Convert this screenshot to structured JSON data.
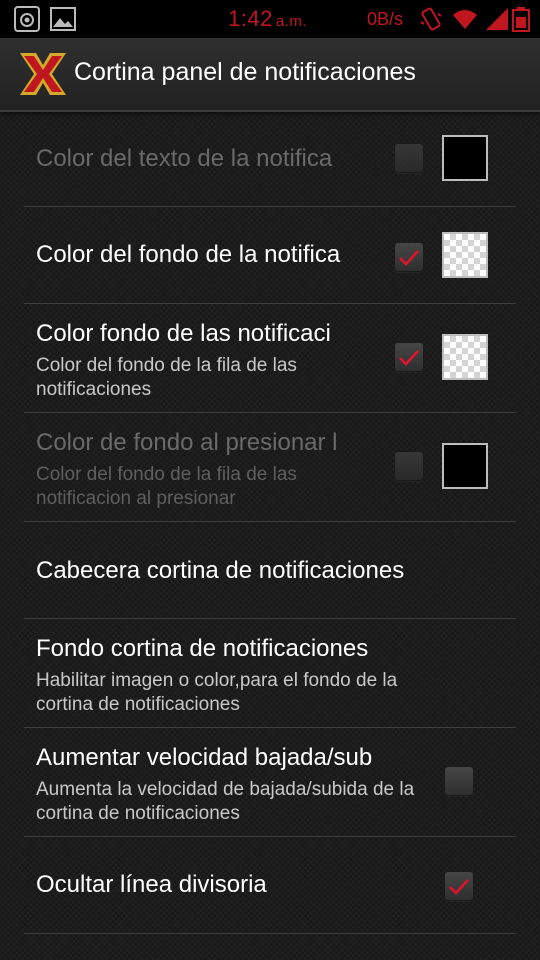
{
  "status_bar": {
    "time": "1:42",
    "ampm": "a.m.",
    "network_speed": "0B/s",
    "icons": [
      "screenshot-icon",
      "image-icon",
      "vibrate-icon",
      "wifi-icon",
      "signal-icon",
      "battery-icon"
    ]
  },
  "action_bar": {
    "title": "Cortina panel de notificaciones",
    "logo": "app-x-logo-icon"
  },
  "colors": {
    "accent": "#c0171f",
    "background": "#1c1c1c",
    "divider": "#3e3e3e"
  },
  "preferences": [
    {
      "title": "Color del texto de la notifica",
      "summary": "",
      "checked": false,
      "enabled": false,
      "swatch": "black"
    },
    {
      "title": "Color del fondo de la notifica",
      "summary": "",
      "checked": true,
      "enabled": true,
      "swatch": "transparent"
    },
    {
      "title": "Color fondo de las notificaci",
      "summary": "Color del fondo de la fila de las notificaciones",
      "checked": true,
      "enabled": true,
      "swatch": "transparent"
    },
    {
      "title": "Color de fondo al presionar l",
      "summary": "Color del fondo de la fila de las notificacion al presionar",
      "checked": false,
      "enabled": false,
      "swatch": "black"
    },
    {
      "title": "Cabecera cortina de notificaciones",
      "summary": "",
      "enabled": true
    },
    {
      "title": "Fondo cortina de notificaciones",
      "summary": "Habilitar imagen o color,para el fondo de la cortina de notificaciones",
      "enabled": true
    },
    {
      "title": "Aumentar velocidad bajada/sub",
      "summary": "Aumenta la velocidad de bajada/subida de la cortina de notificaciones",
      "checked": false,
      "enabled": true
    },
    {
      "title": "Ocultar línea divisoria",
      "summary": "",
      "checked": true,
      "enabled": true
    }
  ]
}
